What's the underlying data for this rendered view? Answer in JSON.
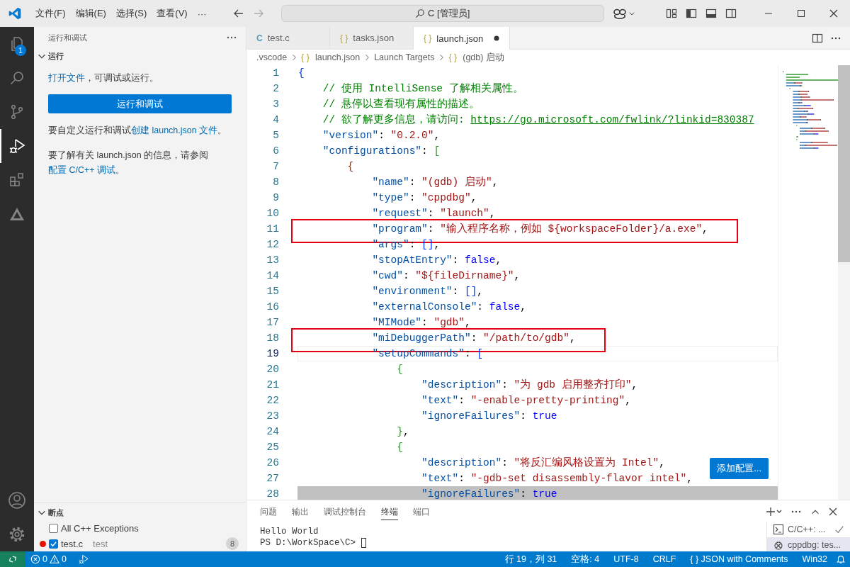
{
  "title_bar": {
    "menu": [
      {
        "label": "文件(F)"
      },
      {
        "label": "编辑(E)"
      },
      {
        "label": "选择(S)"
      },
      {
        "label": "查看(V)"
      },
      {
        "label": "···"
      }
    ],
    "search": {
      "text": "C [管理员]"
    }
  },
  "activity_bar": {
    "items": [
      {
        "kind": "explorer",
        "selected": false,
        "badge": "1"
      },
      {
        "kind": "search",
        "selected": false
      },
      {
        "kind": "source-control",
        "selected": false
      },
      {
        "kind": "run-debug",
        "selected": true
      },
      {
        "kind": "extensions",
        "selected": false
      },
      {
        "kind": "triangle",
        "selected": false
      }
    ],
    "bottom": [
      {
        "kind": "account"
      },
      {
        "kind": "settings"
      }
    ]
  },
  "sidebar": {
    "title": "运行和调试",
    "run_section": {
      "title": "运行",
      "expanded": true,
      "blocks": [
        {
          "kind": "paragraph",
          "parts": [
            {
              "text": "打开文件",
              "link": true
            },
            {
              "text": "，可调试或运行。",
              "link": false
            }
          ]
        },
        {
          "kind": "button",
          "label": "运行和调试"
        },
        {
          "kind": "paragraph",
          "parts": [
            {
              "text": "要自定义运行和调试",
              "link": false
            },
            {
              "text": "创建 launch.json 文件",
              "link": true
            },
            {
              "text": "。",
              "link": false
            }
          ]
        },
        {
          "kind": "paragraph",
          "parts": [
            {
              "text": "要了解有关 launch.json 的信息，请参阅 ",
              "link": false
            },
            {
              "text": "配置 C/C++ 调试",
              "link": true
            },
            {
              "text": "。",
              "link": false
            }
          ]
        }
      ]
    },
    "breakpoints": {
      "title": "断点",
      "expanded": true,
      "items": [
        {
          "label": "All C++ Exceptions",
          "checked": false,
          "dot": false
        },
        {
          "label": "test.c",
          "detail": "test",
          "count": "8",
          "checked": true,
          "dot": true
        }
      ]
    }
  },
  "editor": {
    "tabs": [
      {
        "icon": "C",
        "label": "test.c",
        "selected": false,
        "dirty": false
      },
      {
        "icon": "{ }",
        "label": "tasks.json",
        "selected": false,
        "dirty": false
      },
      {
        "icon": "{ }",
        "label": "launch.json",
        "selected": true,
        "dirty": true
      }
    ],
    "breadcrumb": [
      {
        "text": ".vscode"
      },
      {
        "icon": "{ }",
        "text": "launch.json"
      },
      {
        "text": "Launch Targets"
      },
      {
        "icon": "{ }",
        "text": "(gdb) 启动"
      }
    ],
    "lines": [
      {
        "number": "1",
        "current": false,
        "annotated": false,
        "highlighted": false,
        "tokens": [
          {
            "kind": "bracket",
            "text": "{",
            "color": "#0431fa"
          }
        ]
      },
      {
        "number": "2",
        "current": false,
        "annotated": false,
        "highlighted": false,
        "tokens": [
          {
            "kind": "comment",
            "text": "    // 使用 IntelliSense 了解相关属性。"
          }
        ]
      },
      {
        "number": "3",
        "current": false,
        "annotated": false,
        "highlighted": false,
        "tokens": [
          {
            "kind": "comment",
            "text": "    // 悬停以查看现有属性的描述。"
          }
        ]
      },
      {
        "number": "4",
        "current": false,
        "annotated": false,
        "highlighted": false,
        "tokens": [
          {
            "kind": "comment",
            "text": "    // 欲了解更多信息，请访问: "
          },
          {
            "kind": "link",
            "text": "https://go.microsoft.com/fwlink/?linkid=830387"
          }
        ]
      },
      {
        "number": "5",
        "current": false,
        "annotated": false,
        "highlighted": false,
        "tokens": [
          {
            "kind": "key",
            "text": "    \"version\""
          },
          {
            "kind": "punct",
            "text": ": "
          },
          {
            "kind": "string",
            "text": "\"0.2.0\""
          },
          {
            "kind": "punct",
            "text": ","
          }
        ]
      },
      {
        "number": "6",
        "current": false,
        "annotated": false,
        "highlighted": false,
        "tokens": [
          {
            "kind": "key",
            "text": "    \"configurations\""
          },
          {
            "kind": "punct",
            "text": ": "
          },
          {
            "kind": "bracket",
            "text": "[",
            "color": "#319331"
          }
        ]
      },
      {
        "number": "7",
        "current": false,
        "annotated": false,
        "highlighted": false,
        "tokens": [
          {
            "kind": "bracket",
            "text": "        {",
            "color": "#7b3814"
          }
        ]
      },
      {
        "number": "8",
        "current": false,
        "annotated": false,
        "highlighted": false,
        "tokens": [
          {
            "kind": "key",
            "text": "            \"name\""
          },
          {
            "kind": "punct",
            "text": ": "
          },
          {
            "kind": "string",
            "text": "\"(gdb) 启动\""
          },
          {
            "kind": "punct",
            "text": ","
          }
        ]
      },
      {
        "number": "9",
        "current": false,
        "annotated": false,
        "highlighted": false,
        "tokens": [
          {
            "kind": "key",
            "text": "            \"type\""
          },
          {
            "kind": "punct",
            "text": ": "
          },
          {
            "kind": "string",
            "text": "\"cppdbg\""
          },
          {
            "kind": "punct",
            "text": ","
          }
        ]
      },
      {
        "number": "10",
        "current": false,
        "annotated": false,
        "highlighted": false,
        "tokens": [
          {
            "kind": "key",
            "text": "            \"request\""
          },
          {
            "kind": "punct",
            "text": ": "
          },
          {
            "kind": "string",
            "text": "\"launch\""
          },
          {
            "kind": "punct",
            "text": ","
          }
        ]
      },
      {
        "number": "11",
        "current": false,
        "annotated": true,
        "highlighted": false,
        "tokens": [
          {
            "kind": "key",
            "text": "            \"program\""
          },
          {
            "kind": "punct",
            "text": ": "
          },
          {
            "kind": "string",
            "text": "\"输入程序名称，例如 ${workspaceFolder}/a.exe\""
          },
          {
            "kind": "punct",
            "text": ","
          }
        ]
      },
      {
        "number": "12",
        "current": false,
        "annotated": false,
        "highlighted": false,
        "tokens": [
          {
            "kind": "key",
            "text": "            \"args\""
          },
          {
            "kind": "punct",
            "text": ": "
          },
          {
            "kind": "bracket",
            "text": "[]",
            "color": "#0431fa"
          },
          {
            "kind": "punct",
            "text": ","
          }
        ]
      },
      {
        "number": "13",
        "current": false,
        "annotated": false,
        "highlighted": false,
        "tokens": [
          {
            "kind": "key",
            "text": "            \"stopAtEntry\""
          },
          {
            "kind": "punct",
            "text": ": "
          },
          {
            "kind": "bool",
            "text": "false"
          },
          {
            "kind": "punct",
            "text": ","
          }
        ]
      },
      {
        "number": "14",
        "current": false,
        "annotated": false,
        "highlighted": false,
        "tokens": [
          {
            "kind": "key",
            "text": "            \"cwd\""
          },
          {
            "kind": "punct",
            "text": ": "
          },
          {
            "kind": "string",
            "text": "\"${fileDirname}\""
          },
          {
            "kind": "punct",
            "text": ","
          }
        ]
      },
      {
        "number": "15",
        "current": false,
        "annotated": false,
        "highlighted": false,
        "tokens": [
          {
            "kind": "key",
            "text": "            \"environment\""
          },
          {
            "kind": "punct",
            "text": ": "
          },
          {
            "kind": "bracket",
            "text": "[]",
            "color": "#0431fa"
          },
          {
            "kind": "punct",
            "text": ","
          }
        ]
      },
      {
        "number": "16",
        "current": false,
        "annotated": false,
        "highlighted": false,
        "tokens": [
          {
            "kind": "key",
            "text": "            \"externalConsole\""
          },
          {
            "kind": "punct",
            "text": ": "
          },
          {
            "kind": "bool",
            "text": "false"
          },
          {
            "kind": "punct",
            "text": ","
          }
        ]
      },
      {
        "number": "17",
        "current": false,
        "annotated": false,
        "highlighted": false,
        "tokens": [
          {
            "kind": "key",
            "text": "            \"MIMode\""
          },
          {
            "kind": "punct",
            "text": ": "
          },
          {
            "kind": "string",
            "text": "\"gdb\""
          },
          {
            "kind": "punct",
            "text": ","
          }
        ]
      },
      {
        "number": "18",
        "current": false,
        "annotated": true,
        "highlighted": false,
        "tokens": [
          {
            "kind": "key",
            "text": "            \"miDebuggerPath\""
          },
          {
            "kind": "punct",
            "text": ": "
          },
          {
            "kind": "string",
            "text": "\"/path/to/gdb\""
          },
          {
            "kind": "punct",
            "text": ","
          }
        ]
      },
      {
        "number": "19",
        "current": true,
        "annotated": false,
        "highlighted": false,
        "tokens": [
          {
            "kind": "key",
            "text": "            \"setupCommands\""
          },
          {
            "kind": "punct",
            "text": ": "
          },
          {
            "kind": "bracket",
            "text": "[",
            "color": "#0431fa"
          }
        ]
      },
      {
        "number": "20",
        "current": false,
        "annotated": false,
        "highlighted": false,
        "tokens": [
          {
            "kind": "bracket",
            "text": "                {",
            "color": "#319331"
          }
        ]
      },
      {
        "number": "21",
        "current": false,
        "annotated": false,
        "highlighted": false,
        "tokens": [
          {
            "kind": "key",
            "text": "                    \"description\""
          },
          {
            "kind": "punct",
            "text": ": "
          },
          {
            "kind": "string",
            "text": "\"为 gdb 启用整齐打印\""
          },
          {
            "kind": "punct",
            "text": ","
          }
        ]
      },
      {
        "number": "22",
        "current": false,
        "annotated": false,
        "highlighted": false,
        "tokens": [
          {
            "kind": "key",
            "text": "                    \"text\""
          },
          {
            "kind": "punct",
            "text": ": "
          },
          {
            "kind": "string",
            "text": "\"-enable-pretty-printing\""
          },
          {
            "kind": "punct",
            "text": ","
          }
        ]
      },
      {
        "number": "23",
        "current": false,
        "annotated": false,
        "highlighted": false,
        "tokens": [
          {
            "kind": "key",
            "text": "                    \"ignoreFailures\""
          },
          {
            "kind": "punct",
            "text": ": "
          },
          {
            "kind": "bool",
            "text": "true"
          }
        ]
      },
      {
        "number": "24",
        "current": false,
        "annotated": false,
        "highlighted": false,
        "tokens": [
          {
            "kind": "bracket",
            "text": "                }",
            "color": "#319331"
          },
          {
            "kind": "punct",
            "text": ","
          }
        ]
      },
      {
        "number": "25",
        "current": false,
        "annotated": false,
        "highlighted": false,
        "tokens": [
          {
            "kind": "bracket",
            "text": "                {",
            "color": "#319331"
          }
        ]
      },
      {
        "number": "26",
        "current": false,
        "annotated": false,
        "highlighted": false,
        "tokens": [
          {
            "kind": "key",
            "text": "                    \"description\""
          },
          {
            "kind": "punct",
            "text": ": "
          },
          {
            "kind": "string",
            "text": "\"将反汇编风格设置为 Intel\""
          },
          {
            "kind": "punct",
            "text": ","
          }
        ]
      },
      {
        "number": "27",
        "current": false,
        "annotated": false,
        "highlighted": false,
        "tokens": [
          {
            "kind": "key",
            "text": "                    \"text\""
          },
          {
            "kind": "punct",
            "text": ": "
          },
          {
            "kind": "string",
            "text": "\"-gdb-set disassembly-flavor intel\""
          },
          {
            "kind": "punct",
            "text": ","
          }
        ]
      },
      {
        "number": "28",
        "current": false,
        "annotated": false,
        "highlighted": true,
        "tokens": [
          {
            "kind": "key",
            "text": "                    \"ignoreFailures\""
          },
          {
            "kind": "punct",
            "text": ": "
          },
          {
            "kind": "bool",
            "text": "true"
          }
        ]
      }
    ],
    "add_button": {
      "label": "添加配置..."
    }
  },
  "panel": {
    "tabs": [
      {
        "label": "问题",
        "selected": false
      },
      {
        "label": "输出",
        "selected": false
      },
      {
        "label": "调试控制台",
        "selected": false
      },
      {
        "label": "终端",
        "selected": true
      },
      {
        "label": "端口",
        "selected": false
      }
    ],
    "terminal_lines": [
      "Hello World",
      "PS D:\\WorkSpace\\C> "
    ],
    "terminals": [
      {
        "kind": "task",
        "label": "C/C++: ...",
        "selected": false,
        "done": true
      },
      {
        "kind": "debug",
        "label": "cppdbg: tes...",
        "selected": true,
        "done": false
      }
    ]
  },
  "status_bar": {
    "errors": "0",
    "warnings": "0",
    "items": [
      {
        "text": "行 19，列 31"
      },
      {
        "text": "空格: 4"
      },
      {
        "text": "UTF-8"
      },
      {
        "text": "CRLF"
      },
      {
        "text": "{ } JSON with Comments"
      },
      {
        "text": "Win32"
      }
    ]
  }
}
